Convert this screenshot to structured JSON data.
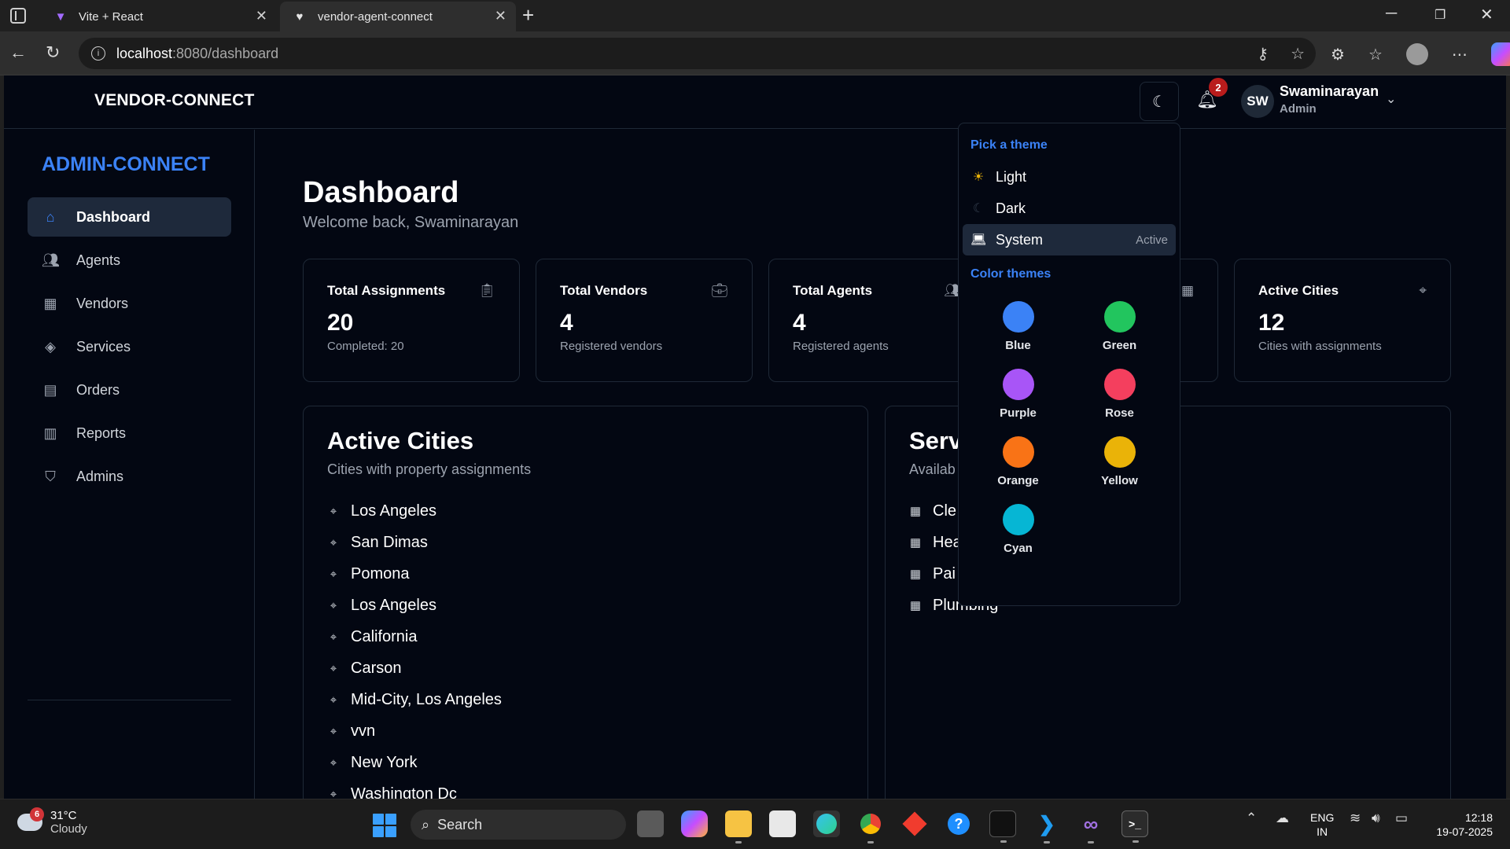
{
  "browser": {
    "tabs": [
      {
        "title": "Vite + React",
        "active": false
      },
      {
        "title": "vendor-agent-connect",
        "active": true
      }
    ],
    "url_host": "localhost",
    "url_path": ":8080/dashboard"
  },
  "header": {
    "brand": "VENDOR-CONNECT",
    "notification_count": "2",
    "user_initials": "SW",
    "user_name": "Swaminarayan",
    "user_role": "Admin"
  },
  "sidebar": {
    "brand": "ADMIN-CONNECT",
    "items": [
      {
        "label": "Dashboard",
        "icon": "home-icon",
        "active": true
      },
      {
        "label": "Agents",
        "icon": "users-icon",
        "active": false
      },
      {
        "label": "Vendors",
        "icon": "building-icon",
        "active": false
      },
      {
        "label": "Services",
        "icon": "layers-icon",
        "active": false
      },
      {
        "label": "Orders",
        "icon": "file-icon",
        "active": false
      },
      {
        "label": "Reports",
        "icon": "bar-chart-icon",
        "active": false
      },
      {
        "label": "Admins",
        "icon": "shield-icon",
        "active": false
      }
    ]
  },
  "main": {
    "title": "Dashboard",
    "subtitle": "Welcome back, Swaminarayan",
    "stats": [
      {
        "label": "Total Assignments",
        "value": "20",
        "note": "Completed: 20",
        "icon": "clipboard-check-icon"
      },
      {
        "label": "Total Vendors",
        "value": "4",
        "note": "Registered vendors",
        "icon": "briefcase-icon"
      },
      {
        "label": "Total Agents",
        "value": "4",
        "note": "Registered agents",
        "icon": "users-icon"
      },
      {
        "label": "",
        "value": "",
        "note": "",
        "icon": "building-icon"
      },
      {
        "label": "Active Cities",
        "value": "12",
        "note": "Cities with assignments",
        "icon": "map-pin-icon"
      }
    ],
    "cities_panel": {
      "title": "Active Cities",
      "subtitle": "Cities with property assignments",
      "cities": [
        "Los Angeles",
        "San Dimas",
        "Pomona",
        "Los Angeles",
        "California",
        "Carson",
        "Mid-City, Los Angeles",
        "vvn",
        "New York",
        "Washington Dc"
      ]
    },
    "services_panel": {
      "title": "Serv",
      "subtitle": "Availab",
      "services": [
        "Cle",
        "Hea",
        "Pai",
        "Plumbing"
      ]
    }
  },
  "theme_menu": {
    "pick_label": "Pick a theme",
    "modes": [
      {
        "label": "Light",
        "icon": "sun-icon",
        "selected": false
      },
      {
        "label": "Dark",
        "icon": "moon-icon",
        "selected": false
      },
      {
        "label": "System",
        "icon": "laptop-icon",
        "selected": true,
        "tag": "Active"
      }
    ],
    "color_label": "Color themes",
    "colors": [
      {
        "name": "Blue",
        "hex": "#3b82f6"
      },
      {
        "name": "Green",
        "hex": "#22c55e"
      },
      {
        "name": "Purple",
        "hex": "#a855f7"
      },
      {
        "name": "Rose",
        "hex": "#f43f5e"
      },
      {
        "name": "Orange",
        "hex": "#f97316"
      },
      {
        "name": "Yellow",
        "hex": "#eab308"
      },
      {
        "name": "Cyan",
        "hex": "#06b6d4"
      }
    ]
  },
  "taskbar": {
    "weather_temp": "31°C",
    "weather_desc": "Cloudy",
    "weather_badge": "6",
    "search_label": "Search",
    "lang_1": "ENG",
    "lang_2": "IN",
    "time": "12:18",
    "date": "19-07-2025"
  }
}
